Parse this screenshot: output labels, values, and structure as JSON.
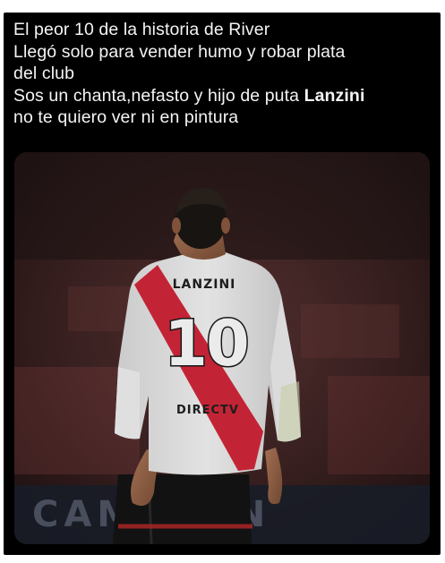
{
  "tweet": {
    "lines": [
      "El peor 10 de la historia de River",
      "Llegó solo para vender humo y robar plata",
      "del club",
      "Sos un chanta,nefasto y hijo de puta ",
      "no te quiero ver ni en pintura"
    ],
    "bold_name": "Lanzini"
  },
  "photo": {
    "shirt_name": "LANZINI",
    "shirt_number": "10",
    "sponsor": "DIRECTV",
    "banner_text": "CAMPEÓN"
  },
  "colors": {
    "background": "#ffffff",
    "card": "#000000",
    "text": "#f4f4f4",
    "jersey_sash": "#d4283a"
  }
}
